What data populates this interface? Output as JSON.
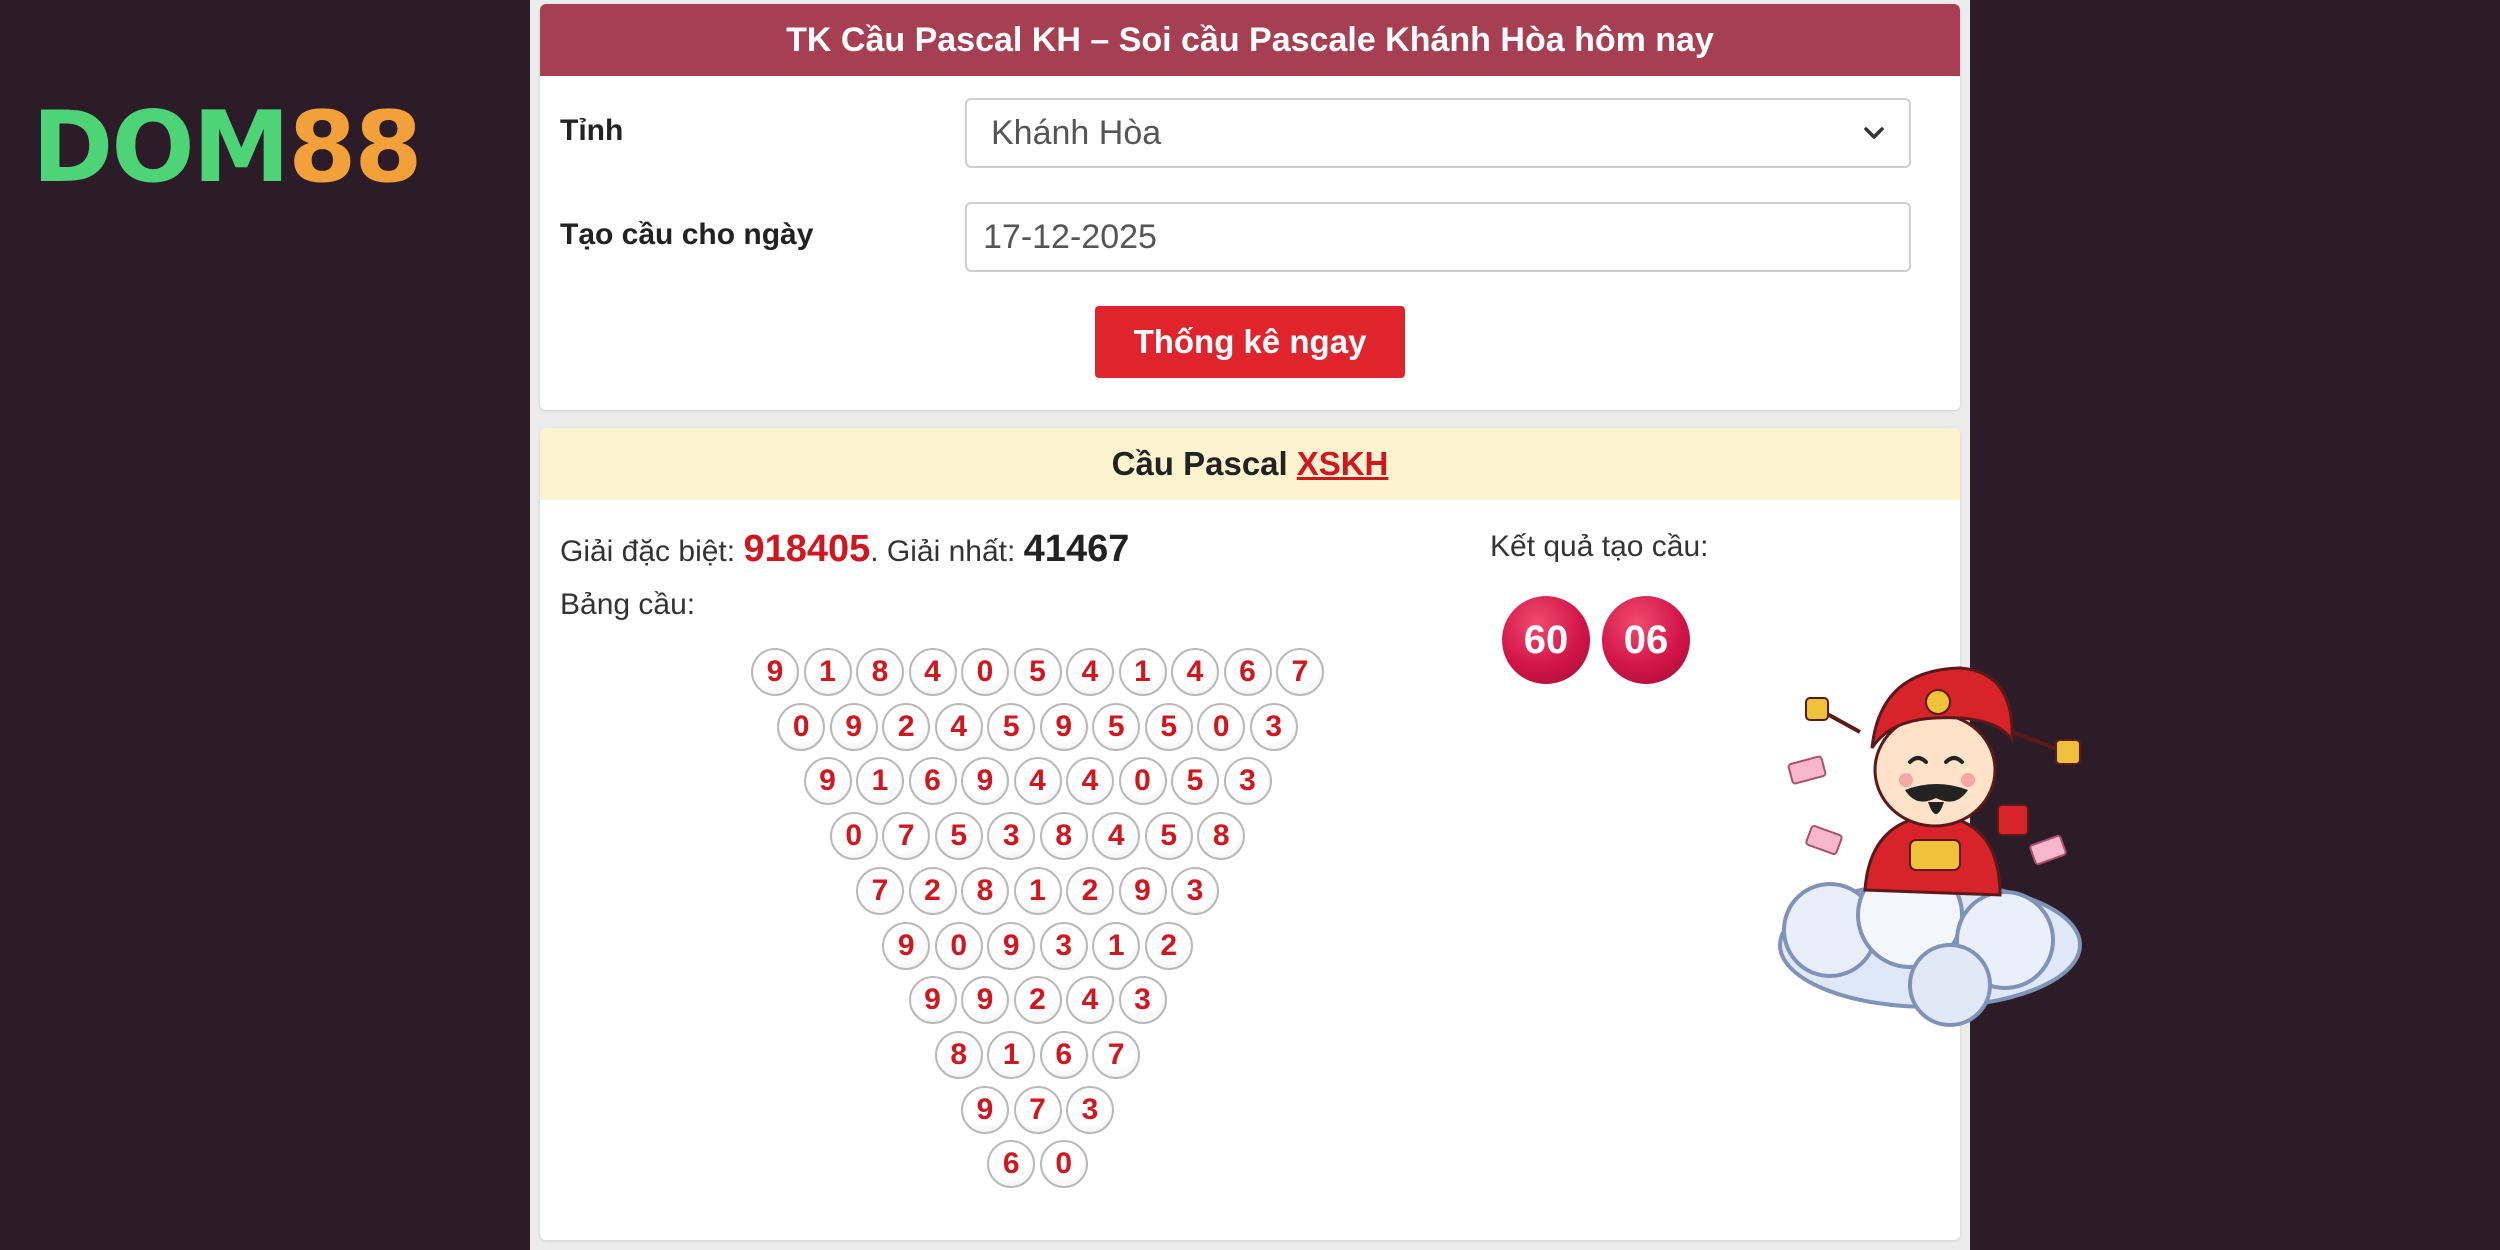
{
  "logo": {
    "part1": "DOM",
    "part2": "88"
  },
  "form": {
    "title": "TK Cầu Pascal KH – Soi cầu Pascale Khánh Hòa hôm nay",
    "province_label": "Tỉnh",
    "province_value": "Khánh Hòa",
    "date_label": "Tạo cầu cho ngày",
    "date_value": "17-12-2025",
    "submit_label": "Thống kê ngay"
  },
  "result": {
    "heading": "Cầu Pascal",
    "heading_link": "XSKH",
    "special_label": "Giải đặc biệt:",
    "special_value": "918405",
    "first_label": ". Giải nhất:",
    "first_value": "41467",
    "table_label": "Bảng cầu:",
    "result_label": "Kết quả tạo cầu:",
    "result_balls": [
      "60",
      "06"
    ],
    "pyramid": [
      [
        "9",
        "1",
        "8",
        "4",
        "0",
        "5",
        "4",
        "1",
        "4",
        "6",
        "7"
      ],
      [
        "0",
        "9",
        "2",
        "4",
        "5",
        "9",
        "5",
        "5",
        "0",
        "3"
      ],
      [
        "9",
        "1",
        "6",
        "9",
        "4",
        "4",
        "0",
        "5",
        "3"
      ],
      [
        "0",
        "7",
        "5",
        "3",
        "8",
        "4",
        "5",
        "8"
      ],
      [
        "7",
        "2",
        "8",
        "1",
        "2",
        "9",
        "3"
      ],
      [
        "9",
        "0",
        "9",
        "3",
        "1",
        "2"
      ],
      [
        "9",
        "9",
        "2",
        "4",
        "3"
      ],
      [
        "8",
        "1",
        "6",
        "7"
      ],
      [
        "9",
        "7",
        "3"
      ],
      [
        "6",
        "0"
      ]
    ]
  },
  "colors": {
    "header": "#a63f52",
    "button": "#e0242e",
    "accent_red": "#d0171f",
    "subheader_bg": "#fdf4cf",
    "page_bg": "#2b1c27"
  },
  "icons": {
    "select_caret": "chevron-down-icon",
    "mascot": "god-of-wealth-mascot"
  }
}
